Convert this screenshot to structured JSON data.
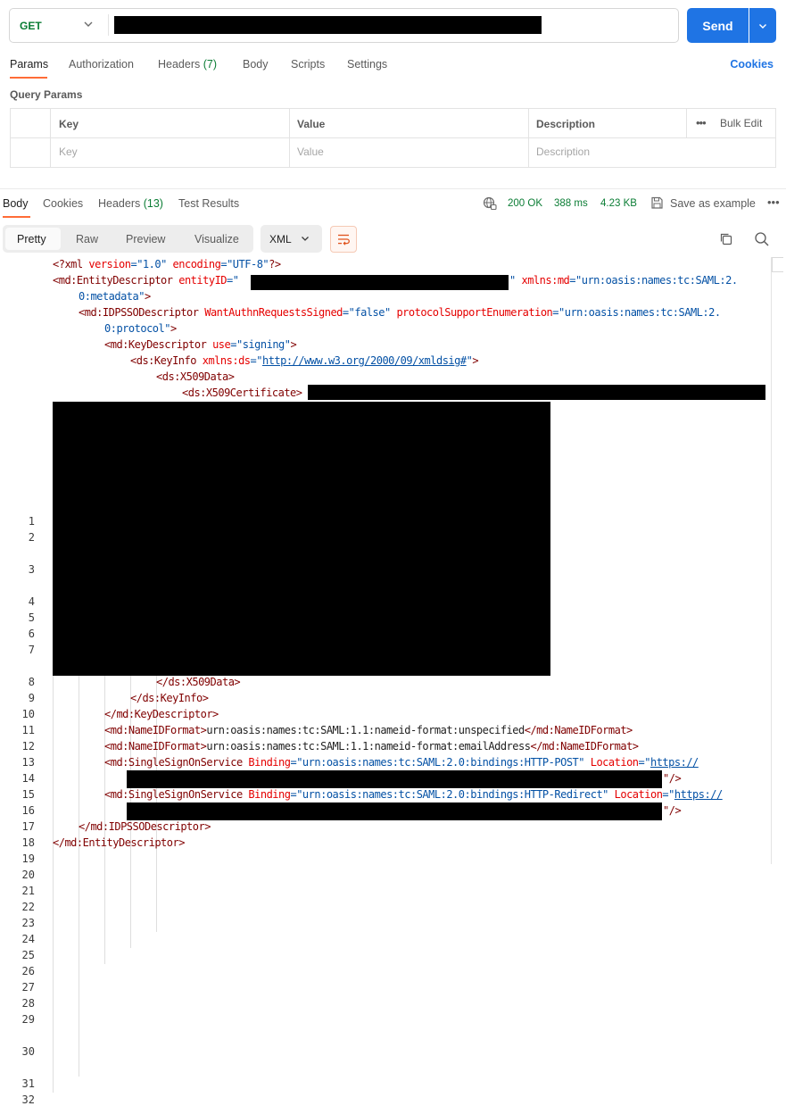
{
  "request": {
    "method": "GET",
    "send_label": "Send",
    "tabs": [
      {
        "label": "Params"
      },
      {
        "label": "Authorization"
      },
      {
        "label": "Headers",
        "count": "(7)"
      },
      {
        "label": "Body"
      },
      {
        "label": "Scripts"
      },
      {
        "label": "Settings"
      }
    ],
    "cookies_label": "Cookies",
    "query_params_title": "Query Params",
    "table": {
      "headers": [
        "Key",
        "Value",
        "Description"
      ],
      "placeholders": [
        "Key",
        "Value",
        "Description"
      ],
      "bulk_edit": "Bulk Edit"
    }
  },
  "response": {
    "tabs": [
      {
        "label": "Body"
      },
      {
        "label": "Cookies"
      },
      {
        "label": "Headers",
        "count": "(13)"
      },
      {
        "label": "Test Results"
      }
    ],
    "status": "200 OK",
    "time": "388 ms",
    "size": "4.23 KB",
    "save_example": "Save as example",
    "views": [
      "Pretty",
      "Raw",
      "Preview",
      "Visualize"
    ],
    "format": "XML"
  },
  "code": {
    "line_numbers": [
      "1",
      "2",
      "3",
      "4",
      "5",
      "6",
      "7",
      "8",
      "9",
      "10",
      "11",
      "12",
      "13",
      "14",
      "15",
      "16",
      "17",
      "18",
      "19",
      "20",
      "21",
      "22",
      "23",
      "24",
      "25",
      "26",
      "27",
      "28",
      "29",
      "30",
      "31",
      "32"
    ],
    "xml_decl": {
      "open": "<?",
      "name": "xml",
      "a1": "version",
      "v1": "\"1.0\"",
      "a2": "encoding",
      "v2": "\"UTF-8\"",
      "close": "?>"
    },
    "entity_descriptor": {
      "open": "<md:EntityDescriptor",
      "a1": "entityID",
      "q": "=\"",
      "q_end": "\"",
      "a2": "xmlns:md",
      "v2_a": "=\"urn:oasis:names:tc:SAML:2.",
      "v2_b": "0:metadata\"",
      "end": ">"
    },
    "idpsso": {
      "open": "<md:IDPSSODescriptor",
      "a1": "WantAuthnRequestsSigned",
      "v1": "=\"false\"",
      "a2": "protocolSupportEnumeration",
      "v2_a": "=\"urn:oasis:names:tc:SAML:2.",
      "v2_b": "0:protocol\"",
      "end": ">"
    },
    "key_descriptor": {
      "open": "<md:KeyDescriptor",
      "a1": "use",
      "v1": "=\"signing\"",
      "end": ">"
    },
    "keyinfo": {
      "open": "<ds:KeyInfo",
      "a1": "xmlns:ds",
      "eq": "=\"",
      "link": "http://www.w3.org/2000/09/xmldsig#",
      "q_end": "\"",
      "end": ">"
    },
    "x509data": "<ds:X509Data>",
    "x509cert": "<ds:X509Certificate>",
    "x509data_close": "</ds:X509Data>",
    "keyinfo_close": "</ds:KeyInfo>",
    "key_descriptor_close": "</md:KeyDescriptor>",
    "nameid1": {
      "open": "<md:NameIDFormat>",
      "text": "urn:oasis:names:tc:SAML:1.1:nameid-format:unspecified",
      "close": "</md:NameIDFormat>"
    },
    "nameid2": {
      "open": "<md:NameIDFormat>",
      "text": "urn:oasis:names:tc:SAML:1.1:nameid-format:emailAddress",
      "close": "</md:NameIDFormat>"
    },
    "sso1": {
      "open": "<md:SingleSignOnService",
      "a1": "Binding",
      "v1": "=\"urn:oasis:names:tc:SAML:2.0:bindings:HTTP-POST\"",
      "a2": "Location",
      "eq": "=\"",
      "link": "https://",
      "tail": "\"/>"
    },
    "sso2": {
      "open": "<md:SingleSignOnService",
      "a1": "Binding",
      "v1": "=\"urn:oasis:names:tc:SAML:2.0:bindings:HTTP-Redirect\"",
      "a2": "Location",
      "eq": "=\"",
      "link": "https://",
      "tail": "\"/>"
    },
    "idpsso_close": "</md:IDPSSODescriptor>",
    "entity_close": "</md:EntityDescriptor>"
  }
}
